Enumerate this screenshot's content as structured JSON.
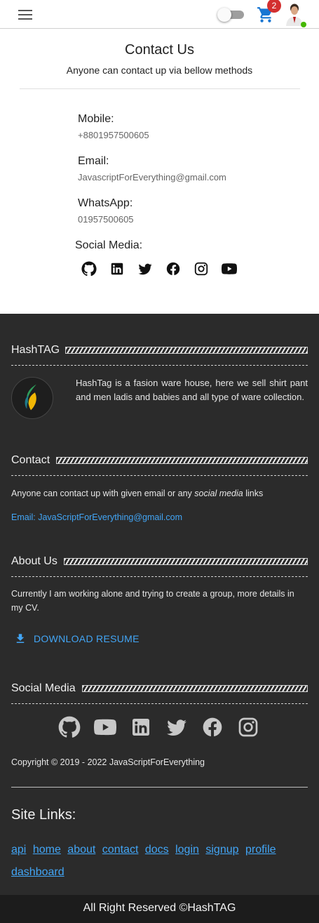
{
  "header": {
    "cart_count": "2",
    "icons": {
      "menu": "menu-icon",
      "cart": "cart-icon",
      "theme_toggle": "theme-toggle"
    }
  },
  "contact": {
    "title": "Contact Us",
    "subtitle": "Anyone can contact up via bellow methods",
    "mobile_label": "Mobile:",
    "mobile_value": "+8801957500605",
    "email_label": "Email:",
    "email_value": "JavascriptForEverything@gmail.com",
    "whatsapp_label": "WhatsApp:",
    "whatsapp_value": "01957500605",
    "social_label": "Social Media:",
    "social_icons": [
      "github-icon",
      "linkedin-icon",
      "twitter-icon",
      "facebook-icon",
      "instagram-icon",
      "youtube-icon"
    ]
  },
  "footer": {
    "hashtag_heading": "HashTAG",
    "about_text": "HashTag is a fasion ware house, here we sell shirt pant and men ladis and babies and all type of ware collection.",
    "contact_heading": "Contact",
    "contact_text_pre": "Anyone can contact up with given email or any ",
    "contact_text_em": "social media",
    "contact_text_post": " links",
    "email_line": "Email: JavaScriptForEverything@gmail.com",
    "about_heading": "About Us",
    "about_us_text": "Currently I am working alone and trying to create a group, more details in my CV.",
    "download_label": "DOWNLOAD RESUME",
    "social_heading": "Social Media",
    "social_icons": [
      "github-icon",
      "youtube-icon",
      "linkedin-icon",
      "twitter-icon",
      "facebook-icon",
      "instagram-icon"
    ],
    "copyright": "Copyright © 2019 - 2022 JavaScriptForEverything",
    "site_links_title": "Site Links:",
    "site_links": [
      "api",
      "home",
      "about",
      "contact",
      "docs",
      "login",
      "signup",
      "profile",
      "dashboard"
    ],
    "bottom_text": "All Right Reserved ©HashTAG"
  },
  "colors": {
    "accent": "#42a5f5",
    "footer_bg": "#2b2b2b",
    "bottom_bar_bg": "#1c1c1c",
    "badge": "#d32f2f",
    "online": "#44b700"
  }
}
